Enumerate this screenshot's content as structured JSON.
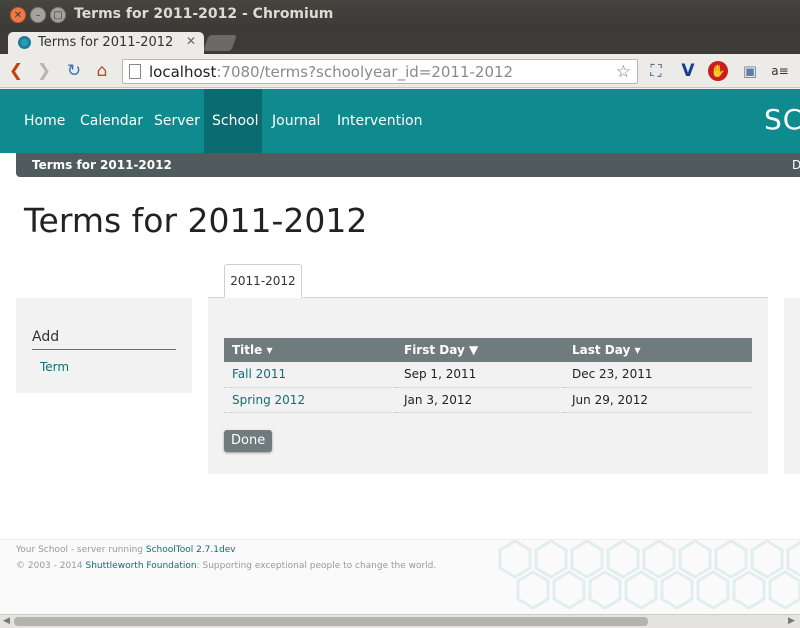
{
  "window": {
    "title": "Terms for 2011-2012 - Chromium"
  },
  "browser": {
    "tab_title": "Terms for 2011-2012",
    "url_host": "localhost",
    "url_rest": ":7080/terms?schoolyear_id=2011-2012",
    "icons": [
      "back-icon",
      "forward-icon",
      "reload-icon",
      "home-icon",
      "star-icon"
    ]
  },
  "nav": {
    "items": [
      "Home",
      "Calendar",
      "Server",
      "School",
      "Journal",
      "Intervention"
    ],
    "active": "School",
    "brand": "SC"
  },
  "breadcrumb": {
    "current": "Terms for 2011-2012",
    "right": "D"
  },
  "page_title": "Terms for 2011-2012",
  "sidebar": {
    "heading": "Add",
    "link": "Term"
  },
  "tabs": [
    "2011-2012"
  ],
  "table": {
    "headers": [
      "Title ▾",
      "First Day ▼",
      "Last Day ▾"
    ],
    "rows": [
      {
        "title": "Fall 2011",
        "first": "Sep 1, 2011",
        "last": "Dec 23, 2011"
      },
      {
        "title": "Spring 2012",
        "first": "Jan 3, 2012",
        "last": "Jun 29, 2012"
      }
    ]
  },
  "done_label": "Done",
  "footer": {
    "line1_prefix": "Your School - server running ",
    "line1_link": "SchoolTool 2.7.1dev",
    "line2_prefix": "© 2003 - 2014 ",
    "line2_link": "Shuttleworth Foundation",
    "line2_suffix": ": Supporting exceptional people to change the world."
  },
  "colors": {
    "brand": "#0f8a8e",
    "nav_active": "#0a6c70",
    "table_header": "#6f7b7c"
  }
}
